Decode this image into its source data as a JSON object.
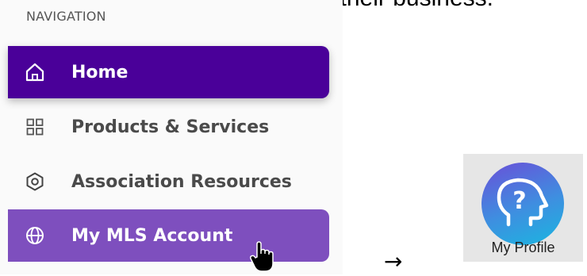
{
  "top_text": "n products that will most benefit their business.",
  "navigation": {
    "heading": "NAVIGATION",
    "items": [
      {
        "label": "Home",
        "icon": "home-icon",
        "state": "active"
      },
      {
        "label": "Products & Services",
        "icon": "grid-icon",
        "state": "normal"
      },
      {
        "label": "Association Resources",
        "icon": "hexagon-icon",
        "state": "normal"
      },
      {
        "label": "My MLS Account",
        "icon": "globe-icon",
        "state": "hover"
      }
    ]
  },
  "arrow": "→",
  "profile": {
    "label": "My Profile",
    "icon": "head-question-icon"
  },
  "colors": {
    "active_bg": "#4a0099",
    "hover_bg": "#7e4fbe",
    "panel_bg": "#fafafa",
    "tile_bg": "#e6e6e6"
  }
}
